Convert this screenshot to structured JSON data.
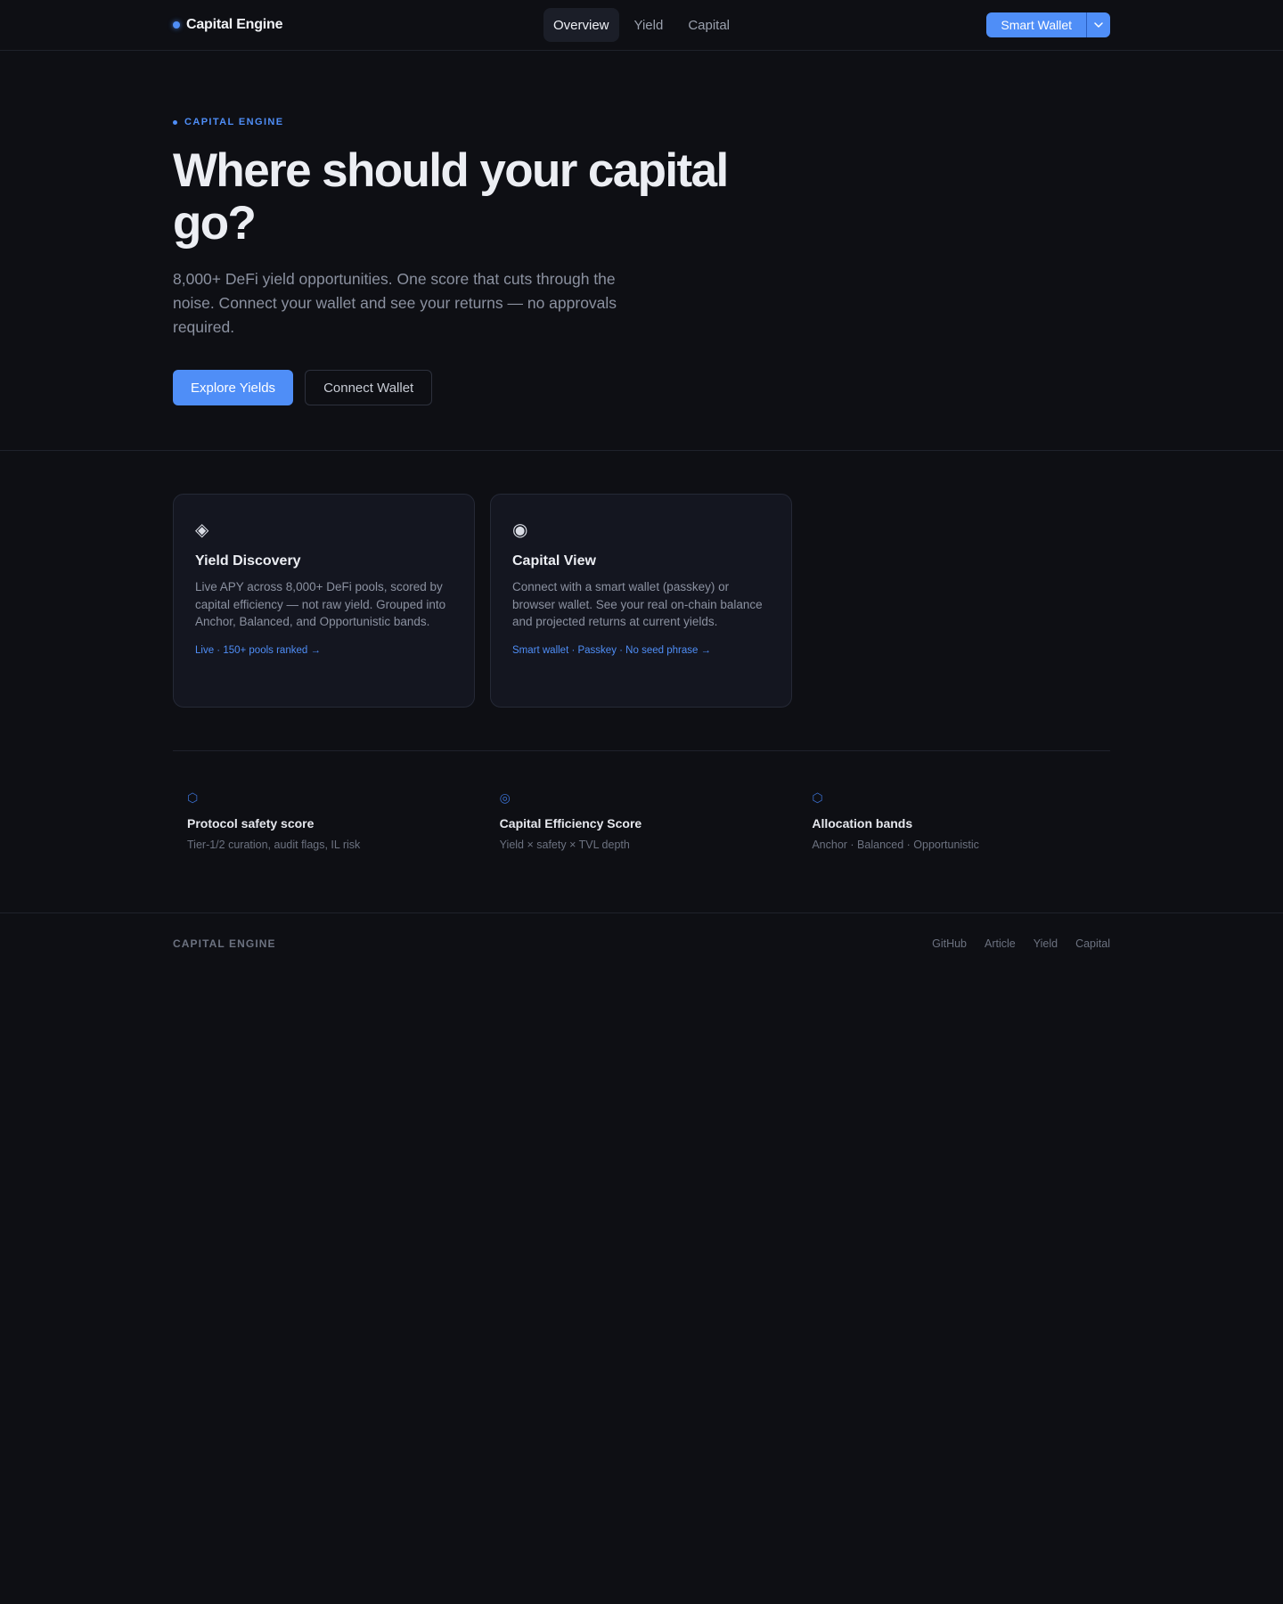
{
  "header": {
    "brand": "Capital Engine",
    "tabs": [
      {
        "label": "Overview",
        "active": true
      },
      {
        "label": "Yield",
        "active": false
      },
      {
        "label": "Capital",
        "active": false
      }
    ],
    "wallet_button": "Smart Wallet"
  },
  "hero": {
    "eyebrow": "CAPITAL ENGINE",
    "headline": "Where should your capital go?",
    "subtext": "8,000+ DeFi yield opportunities. One score that cuts through the noise. Connect your wallet and see your returns — no approvals required.",
    "primary_cta": "Explore Yields",
    "secondary_cta": "Connect Wallet"
  },
  "features": [
    {
      "icon": "diamond-icon",
      "icon_glyph": "◈",
      "title": "Yield Discovery",
      "description": "Live APY across 8,000+ DeFi pools, scored by capital efficiency — not raw yield. Grouped into Anchor, Balanced, and Opportunistic bands.",
      "link": "Live · 150+ pools ranked →"
    },
    {
      "icon": "eye-target-icon",
      "icon_glyph": "◉",
      "title": "Capital View",
      "description": "Connect with a smart wallet (passkey) or browser wallet. See your real on-chain balance and projected returns at current yields.",
      "link": "Smart wallet · Passkey · No seed phrase →"
    }
  ],
  "stats": [
    {
      "icon": "hexagon-icon",
      "icon_glyph": "⬡",
      "title": "Protocol safety score",
      "description": "Tier-1/2 curation, audit flags, IL risk"
    },
    {
      "icon": "concentric-circle-icon",
      "icon_glyph": "◎",
      "title": "Capital Efficiency Score",
      "description": "Yield × safety × TVL depth"
    },
    {
      "icon": "hexagon-icon",
      "icon_glyph": "⬡",
      "title": "Allocation bands",
      "description": "Anchor · Balanced · Opportunistic"
    }
  ],
  "footer": {
    "brand": "CAPITAL ENGINE",
    "links": [
      "GitHub",
      "Article",
      "Yield",
      "Capital"
    ]
  },
  "colors": {
    "background": "#0e0f14",
    "accent": "#4f8ef7",
    "card": "#141620"
  }
}
